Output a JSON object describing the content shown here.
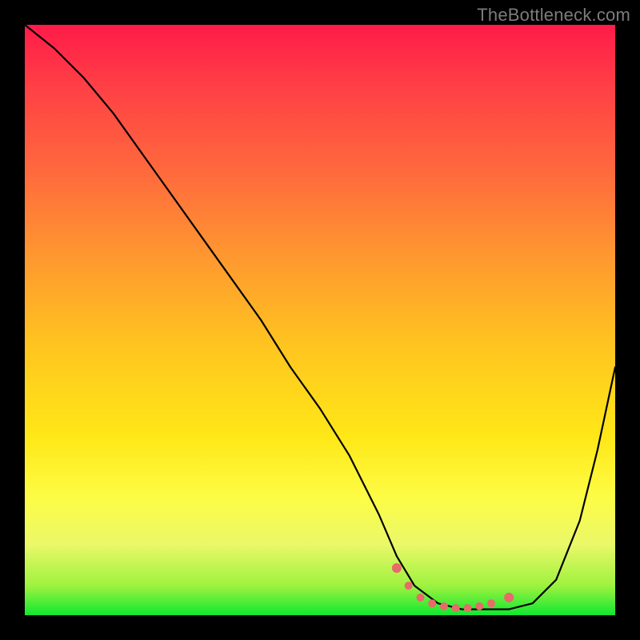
{
  "watermark": "TheBottleneck.com",
  "chart_data": {
    "type": "line",
    "title": "",
    "xlabel": "",
    "ylabel": "",
    "xlim": [
      0,
      100
    ],
    "ylim": [
      0,
      100
    ],
    "series": [
      {
        "name": "bottleneck-curve",
        "x": [
          0,
          5,
          10,
          15,
          20,
          25,
          30,
          35,
          40,
          45,
          50,
          55,
          60,
          63,
          66,
          70,
          74,
          78,
          82,
          86,
          90,
          94,
          97,
          100
        ],
        "y": [
          100,
          96,
          91,
          85,
          78,
          71,
          64,
          57,
          50,
          42,
          35,
          27,
          17,
          10,
          5,
          2,
          1,
          1,
          1,
          2,
          6,
          16,
          28,
          42
        ]
      }
    ],
    "markers": {
      "name": "highlight-dots",
      "color": "#e86a6a",
      "x": [
        63,
        65,
        67,
        69,
        71,
        73,
        75,
        77,
        79,
        82
      ],
      "y": [
        8,
        5,
        3,
        2,
        1.5,
        1.2,
        1.2,
        1.5,
        2,
        3
      ]
    },
    "gradient_stops": [
      {
        "pos": 0.0,
        "color": "#ff1b49"
      },
      {
        "pos": 0.25,
        "color": "#ff6a3d"
      },
      {
        "pos": 0.55,
        "color": "#ffc61f"
      },
      {
        "pos": 0.8,
        "color": "#fdfc45"
      },
      {
        "pos": 1.0,
        "color": "#10e830"
      }
    ]
  }
}
